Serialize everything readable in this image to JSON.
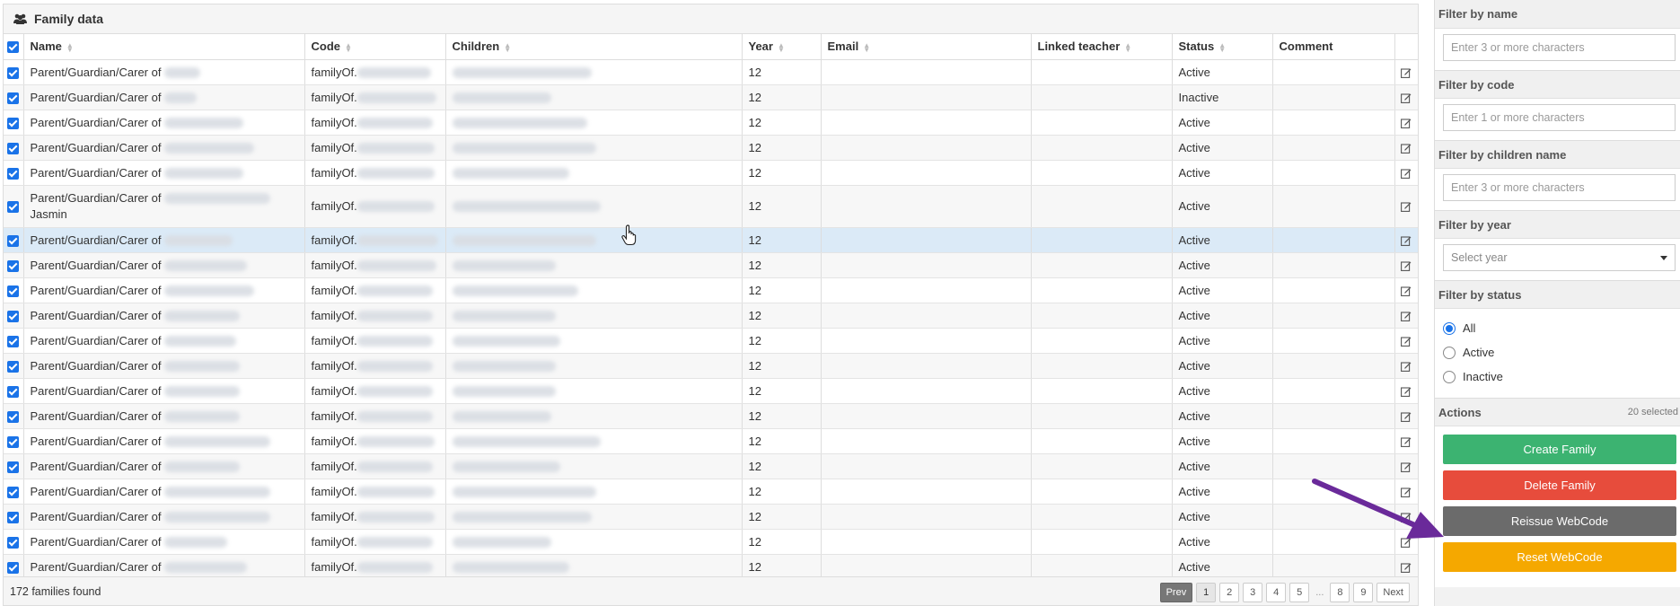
{
  "panel": {
    "title": "Family data",
    "icon": "users-icon"
  },
  "columns": [
    "Name",
    "Code",
    "Children",
    "Year",
    "Email",
    "Linked teacher",
    "Status",
    "Comment"
  ],
  "rows": [
    {
      "name": "Parent/Guardian/Carer of",
      "code": "familyOf.",
      "year": "12",
      "status": "Active"
    },
    {
      "name": "Parent/Guardian/Carer of",
      "code": "familyOf.",
      "year": "12",
      "status": "Inactive"
    },
    {
      "name": "Parent/Guardian/Carer of",
      "code": "familyOf.",
      "year": "12",
      "status": "Active"
    },
    {
      "name": "Parent/Guardian/Carer of",
      "code": "familyOf.",
      "year": "12",
      "status": "Active"
    },
    {
      "name": "Parent/Guardian/Carer of",
      "code": "familyOf.",
      "year": "12",
      "status": "Active"
    },
    {
      "name": "Parent/Guardian/Carer of",
      "name2": "Jasmin",
      "code": "familyOf.",
      "year": "12",
      "status": "Active"
    },
    {
      "name": "Parent/Guardian/Carer of",
      "code": "familyOf.",
      "year": "12",
      "status": "Active"
    },
    {
      "name": "Parent/Guardian/Carer of",
      "code": "familyOf.",
      "year": "12",
      "status": "Active"
    },
    {
      "name": "Parent/Guardian/Carer of",
      "code": "familyOf.",
      "year": "12",
      "status": "Active"
    },
    {
      "name": "Parent/Guardian/Carer of",
      "code": "familyOf.",
      "year": "12",
      "status": "Active"
    },
    {
      "name": "Parent/Guardian/Carer of",
      "code": "familyOf.",
      "year": "12",
      "status": "Active"
    },
    {
      "name": "Parent/Guardian/Carer of",
      "code": "familyOf.",
      "year": "12",
      "status": "Active"
    },
    {
      "name": "Parent/Guardian/Carer of",
      "code": "familyOf.",
      "year": "12",
      "status": "Active"
    },
    {
      "name": "Parent/Guardian/Carer of",
      "code": "familyOf.",
      "year": "12",
      "status": "Active"
    },
    {
      "name": "Parent/Guardian/Carer of",
      "code": "familyOf.",
      "year": "12",
      "status": "Active"
    },
    {
      "name": "Parent/Guardian/Carer of",
      "code": "familyOf.",
      "year": "12",
      "status": "Active"
    },
    {
      "name": "Parent/Guardian/Carer of",
      "code": "familyOf.",
      "year": "12",
      "status": "Active"
    },
    {
      "name": "Parent/Guardian/Carer of",
      "code": "familyOf.",
      "year": "12",
      "status": "Active"
    },
    {
      "name": "Parent/Guardian/Carer of",
      "code": "familyOf.",
      "year": "12",
      "status": "Active"
    },
    {
      "name": "Parent/Guardian/Carer of",
      "code": "familyOf.",
      "year": "12",
      "status": "Active"
    }
  ],
  "footer": {
    "count_text": "172 families found",
    "pagination": {
      "prev": "Prev",
      "pages": [
        "1",
        "2",
        "3",
        "4",
        "5",
        "...",
        "8",
        "9"
      ],
      "next": "Next",
      "current": "1"
    }
  },
  "filters": {
    "name": {
      "label": "Filter by name",
      "placeholder": "Enter 3 or more characters"
    },
    "code": {
      "label": "Filter by code",
      "placeholder": "Enter 1 or more characters"
    },
    "children": {
      "label": "Filter by children name",
      "placeholder": "Enter 3 or more characters"
    },
    "year": {
      "label": "Filter by year",
      "placeholder": "Select year"
    },
    "status": {
      "label": "Filter by status",
      "options": [
        "All",
        "Active",
        "Inactive"
      ],
      "selected": "All"
    }
  },
  "actions": {
    "label": "Actions",
    "selected_count": "20 selected",
    "create": "Create Family",
    "delete": "Delete Family",
    "reissue": "Reissue WebCode",
    "fourth": "Reset WebCode"
  },
  "colors": {
    "create": "#3cb371",
    "delete": "#e74c3c",
    "reissue": "#6b6b6b",
    "fourth": "#f5a800",
    "checkbox": "#1a73e8",
    "highlight_row": "#dbeaf7",
    "annotation_arrow": "#6a2a9a"
  }
}
